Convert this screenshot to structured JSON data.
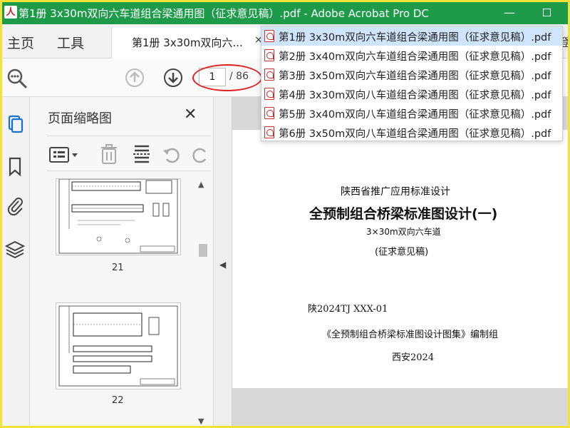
{
  "window": {
    "title": "第1册 3x30m双向六车道组合梁通用图（征求意见稿）.pdf - Adobe Acrobat Pro DC",
    "app_icon_glyph": "人",
    "minimize_glyph": "—"
  },
  "menu": {
    "home_label": "主页",
    "tools_label": "工具",
    "right_edge_char": "登"
  },
  "tab": {
    "label": "第1册 3x30m双向六...",
    "close_glyph": "×"
  },
  "toolbar": {
    "current_page": "1",
    "page_total": "/ 86"
  },
  "panel": {
    "title": "页面缩略图",
    "close_glyph": "✕",
    "thumbnails": [
      {
        "page_label": "21"
      },
      {
        "page_label": "22"
      }
    ]
  },
  "splitter": {
    "arrow": "◀"
  },
  "document": {
    "line1": "陕西省推广应用标准设计",
    "line2": "全预制组合桥梁标准图设计(一)",
    "line3": "3×30m双向六车道",
    "line4": "(征求意见稿)",
    "line5": "陕2024TJ XXX-01",
    "line6": "《全预制组合桥梁标准图设计图集》编制组",
    "line7": "西安2024"
  },
  "dropdown": {
    "items": [
      {
        "label": "第1册 3x30m双向六车道组合梁通用图（征求意见稿）.pdf",
        "selected": true
      },
      {
        "label": "第2册 3x40m双向六车道组合梁通用图（征求意见稿）.pdf",
        "selected": false
      },
      {
        "label": "第3册 3x50m双向六车道组合梁通用图（征求意见稿）.pdf",
        "selected": false
      },
      {
        "label": "第4册 3x30m双向八车道组合梁通用图（征求意见稿）.pdf",
        "selected": false
      },
      {
        "label": "第5册 3x40m双向八车道组合梁通用图（征求意见稿）.pdf",
        "selected": false
      },
      {
        "label": "第6册 3x50m双向八车道组合梁通用图（征求意见稿）.pdf",
        "selected": false
      }
    ]
  },
  "colors": {
    "titlebar": "#1e9b48",
    "annotation_ellipse": "#e02020",
    "frame_border": "#f2e23a",
    "dropdown_selected": "#cfe5fb"
  }
}
